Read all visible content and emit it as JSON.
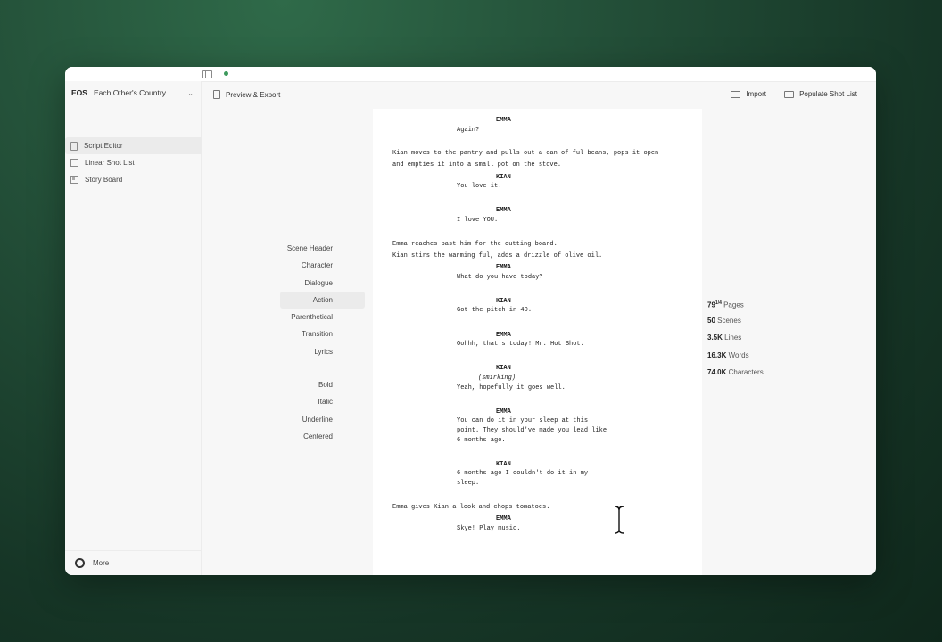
{
  "sidebar": {
    "project_code": "EOS",
    "project_name": "Each Other's Country",
    "items": [
      {
        "label": "Script Editor"
      },
      {
        "label": "Linear Shot List"
      },
      {
        "label": "Story Board"
      }
    ],
    "more_label": "More"
  },
  "toolbar": {
    "preview_label": "Preview & Export",
    "import_label": "Import",
    "populate_label": "Populate Shot List"
  },
  "elements": {
    "items": [
      "Scene Header",
      "Character",
      "Dialogue",
      "Action",
      "Parenthetical",
      "Transition",
      "Lyrics"
    ],
    "formatting": [
      "Bold",
      "Italic",
      "Underline",
      "Centered"
    ],
    "active": "Action"
  },
  "script": [
    {
      "type": "char",
      "text": "EMMA"
    },
    {
      "type": "dial",
      "text": "Again?"
    },
    {
      "type": "act",
      "text": "Kian moves to the pantry and pulls out a can of ful beans, pops it open"
    },
    {
      "type": "act",
      "text": "and empties it into a small pot on the stove."
    },
    {
      "type": "char",
      "text": "KIAN"
    },
    {
      "type": "dial",
      "text": "You love it."
    },
    {
      "type": "char",
      "text": "EMMA"
    },
    {
      "type": "dial",
      "text": "I love YOU."
    },
    {
      "type": "act",
      "text": "Emma reaches past him for the cutting board."
    },
    {
      "type": "act",
      "text": "Kian stirs the warming ful, adds a drizzle of olive oil."
    },
    {
      "type": "char",
      "text": "EMMA"
    },
    {
      "type": "dial",
      "text": "What do you have today?"
    },
    {
      "type": "char",
      "text": "KIAN"
    },
    {
      "type": "dial",
      "text": "Got the pitch in 40."
    },
    {
      "type": "char",
      "text": "EMMA"
    },
    {
      "type": "dial",
      "text": "Oohhh, that's today! Mr. Hot Shot."
    },
    {
      "type": "char",
      "text": "KIAN"
    },
    {
      "type": "paren",
      "text": "(smirking)"
    },
    {
      "type": "dial",
      "text": "Yeah, hopefully it goes well."
    },
    {
      "type": "char",
      "text": "EMMA"
    },
    {
      "type": "dial",
      "text": "You can do it in your sleep at this"
    },
    {
      "type": "dial",
      "text": "point. They should've made you lead like"
    },
    {
      "type": "dial",
      "text": "6 months ago."
    },
    {
      "type": "char",
      "text": "KIAN"
    },
    {
      "type": "dial",
      "text": "6 months ago I couldn't do it in my"
    },
    {
      "type": "dial",
      "text": "sleep."
    },
    {
      "type": "act",
      "text": "Emma gives Kian a look and chops tomatoes."
    },
    {
      "type": "char",
      "text": "EMMA"
    },
    {
      "type": "dial",
      "text": "Skye! Play music."
    }
  ],
  "stats": {
    "pages_value": "79",
    "pages_fraction": "1/4",
    "pages_label": "Pages",
    "scenes_value": "50",
    "scenes_label": "Scenes",
    "lines_value": "3.5K",
    "lines_label": "Lines",
    "words_value": "16.3K",
    "words_label": "Words",
    "characters_value": "74.0K",
    "characters_label": "Characters"
  }
}
